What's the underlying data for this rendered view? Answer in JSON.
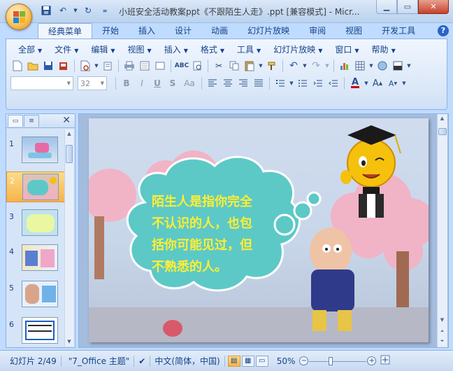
{
  "window": {
    "title": "小班安全活动教案ppt《不跟陌生人走》.ppt [兼容模式] - Micr...",
    "controls": [
      "minimize",
      "maximize",
      "close"
    ]
  },
  "quick_access": [
    "save-icon",
    "undo-icon",
    "redo-icon",
    "customize-icon"
  ],
  "ribbon_tabs": [
    "经典菜单",
    "开始",
    "插入",
    "设计",
    "动画",
    "幻灯片放映",
    "审阅",
    "视图",
    "开发工具"
  ],
  "active_tab": "经典菜单",
  "classic_menu": [
    "全部",
    "文件",
    "编辑",
    "视图",
    "插入",
    "格式",
    "工具",
    "幻灯片放映",
    "窗口",
    "帮助"
  ],
  "font": {
    "name": "",
    "size": "32"
  },
  "format_buttons": [
    "B",
    "I",
    "U",
    "S",
    "Aa"
  ],
  "slides_panel": {
    "selected": 2,
    "thumbs": [
      {
        "num": "1"
      },
      {
        "num": "2"
      },
      {
        "num": "3"
      },
      {
        "num": "4"
      },
      {
        "num": "5"
      },
      {
        "num": "6"
      }
    ]
  },
  "slide": {
    "lines": [
      "陌生人是指你完全",
      "不认识的人，也包",
      "括你可能见过，但",
      "不熟悉的人。"
    ],
    "text_color": "#ffee33",
    "cloud_color": "#5cc9c7"
  },
  "status": {
    "slide_info": "幻灯片 2/49",
    "theme": "\"7_Office 主题\"",
    "language": "中文(简体，中国)",
    "zoom": "50%",
    "zoom_level": 0.5
  },
  "colors": {
    "accent": "#15428b",
    "ribbon": "#dbe8f8"
  }
}
